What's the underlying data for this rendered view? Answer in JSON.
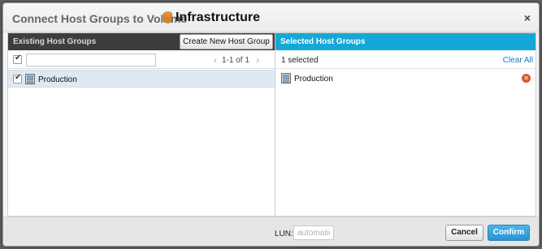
{
  "dialog": {
    "title_prefix": "Connect Host Groups to Volume",
    "volume_name": "Infrastructure",
    "volume_icon": "database-icon",
    "close_symbol": "×"
  },
  "left_panel": {
    "header": "Existing Host Groups",
    "create_button": "Create New Host Group",
    "filter_value": "",
    "pager": "1-1 of 1",
    "select_all_checked": true,
    "items": [
      {
        "label": "Production",
        "checked": true,
        "icon": "host-group-icon"
      }
    ]
  },
  "right_panel": {
    "header": "Selected Host Groups",
    "selected_count": "1 selected",
    "clear_all": "Clear All",
    "items": [
      {
        "label": "Production",
        "icon": "host-group-icon"
      }
    ]
  },
  "footer": {
    "lun_label": "LUN:",
    "lun_placeholder": "automatic",
    "lun_value": "",
    "cancel": "Cancel",
    "confirm": "Confirm"
  },
  "colors": {
    "left_header_bg": "#3d3d3d",
    "right_header_bg": "#14a8d8",
    "confirm_bg": "#2a93d0",
    "link": "#1a76c7",
    "remove": "#e0542c"
  }
}
